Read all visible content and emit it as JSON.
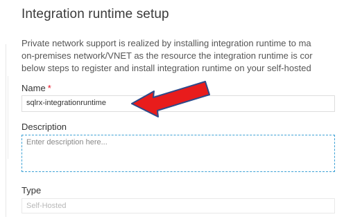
{
  "title": "Integration runtime setup",
  "description_lines": [
    "Private network support is realized by installing integration runtime to ma",
    "on-premises network/VNET as the resource the integration runtime is cor",
    "below steps to register and install integration runtime on your self-hosted"
  ],
  "name_field": {
    "label": "Name",
    "required_mark": "*",
    "value": "sqlrx-integrationruntime"
  },
  "description_field": {
    "label": "Description",
    "placeholder": "Enter description here..."
  },
  "type_field": {
    "label": "Type",
    "value": "Self-Hosted"
  },
  "colors": {
    "arrow_fill": "#e81c1c",
    "arrow_stroke": "#2d4a8a",
    "required": "#e81123",
    "focus_border": "#3aa0d5"
  },
  "icons": {
    "annotation": "red-arrow-icon"
  }
}
